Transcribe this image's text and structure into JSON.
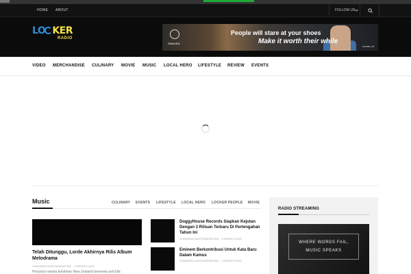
{
  "top_nav": {
    "links": [
      "HOME",
      "ABOUT"
    ],
    "follow_label": "FOLLOW US",
    "follow_chevron": "chevron-down-icon",
    "search_icon": "search-icon"
  },
  "colors": {
    "accent_green": "#1faa37",
    "logo_blue": "#2a8fd6",
    "logo_yellow": "#f2e04a"
  },
  "logo": {
    "word1": "LO",
    "word2": "KER",
    "sub": "RADIO"
  },
  "ad": {
    "brand": "OMAISU",
    "headline": "People will stare at your shoes",
    "tagline": "Make it worth their while",
    "url": "omaisu.id"
  },
  "category_nav": [
    "VIDEO",
    "MERCHANDISE",
    "CULINARY",
    "MOVIE",
    "MUSIC",
    "LOCAL HERO",
    "LIFESTYLE",
    "REVIEW",
    "EVENTS"
  ],
  "music_section": {
    "title": "Music",
    "tabs": [
      "CULINARY",
      "EVENTS",
      "LIFESTYLE",
      "LOCAL HERO",
      "LOCKER PEOPLE",
      "MOVIE"
    ],
    "featured": {
      "title": "Telah Ditunggu, Lorde Akhirnya Rilis Album Melodrama",
      "meta": "CHANDRA MUSTADANSYAH - 2 WEEKS AGO",
      "excerpt": "Penyanyi wanita kelahiran New Zealand bernama asli Ella"
    },
    "posts": [
      {
        "title": "DoggyHouse Records Siapkan Kejutan Dengan 3 Rilisan Terbaru Di Pertengahan Tahun Ini",
        "meta": "CHANDRA MUSTADANSYAH - 3 WEEKS AGO"
      },
      {
        "title": "Eminem Berkontribusi Untuk Kata Baru Dalam Kamus",
        "meta": "CHANDRA MUSTADANSYAH - 4 WEEKS AGO"
      }
    ]
  },
  "sidebar": {
    "title": "RADIO STREAMING",
    "card_line1": "WHERE WORDS FAIL,",
    "card_line2": "MUSIC SPEAKS"
  }
}
